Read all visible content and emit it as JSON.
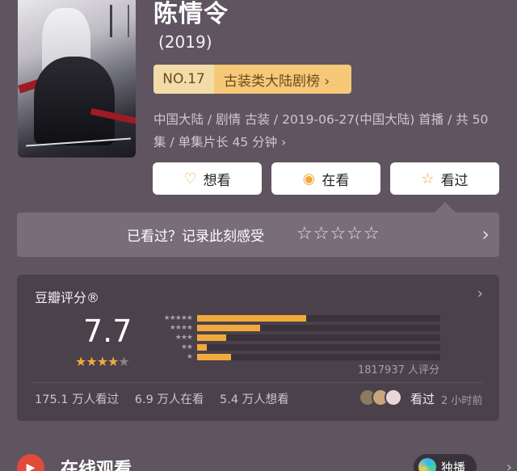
{
  "movie": {
    "title": "陈情令",
    "year": "(2019)",
    "rank_no": "NO.17",
    "rank_category": "古装类大陆剧榜 ›",
    "meta_line1": "中国大陆 / 剧情 古装 / 2019-06-27(中国大陆) 首播 / 共 50",
    "meta_line2": "集 / 单集片长 45 分钟 ›"
  },
  "actions": {
    "want": "想看",
    "watching": "在看",
    "watched": "看过"
  },
  "rate_prompt": {
    "text": "已看过？记录此刻感受",
    "stars": "☆☆☆☆☆",
    "chevron": "›"
  },
  "douban": {
    "label": "豆瓣评分®",
    "chevron": "›",
    "score": "7.7",
    "stars_filled": 4,
    "stars_total": 5,
    "distribution": [
      {
        "label": "★★★★★",
        "value": 0.45
      },
      {
        "label": "★★★★",
        "value": 0.26
      },
      {
        "label": "★★★",
        "value": 0.12
      },
      {
        "label": "★★",
        "value": 0.04
      },
      {
        "label": "★",
        "value": 0.14
      }
    ],
    "count": "1817937 人评分",
    "watched_count": "175.1 万人看过",
    "watching_count": "6.9 万人在看",
    "want_count": "5.4 万人想看",
    "friend_watched": "看过",
    "friend_time": "2 小时前"
  },
  "online": {
    "label": "在线观看",
    "exclusive": "独播",
    "chevron": "›"
  },
  "colors": {
    "background": "#5f5460",
    "accent": "#f2a93b",
    "card": "#4a414b"
  }
}
